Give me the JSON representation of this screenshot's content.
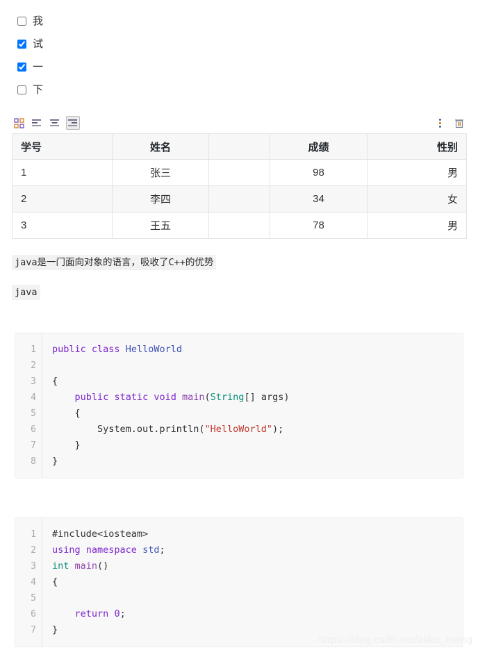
{
  "task_list": {
    "items": [
      {
        "label": "我",
        "checked": false
      },
      {
        "label": "试",
        "checked": true
      },
      {
        "label": "一",
        "checked": true
      },
      {
        "label": "下",
        "checked": false
      }
    ]
  },
  "table_toolbar": {
    "grid_icon": "grid-icon",
    "align_left_icon": "align-left-icon",
    "align_center_icon": "align-center-icon",
    "align_right_icon": "align-right-icon",
    "selected_align": "align-right",
    "more_icon": "more-vertical-icon",
    "delete_icon": "trash-icon"
  },
  "table": {
    "headers": [
      {
        "label": "学号",
        "align": "left"
      },
      {
        "label": "姓名",
        "align": "center"
      },
      {
        "label": "",
        "align": "left"
      },
      {
        "label": "成绩",
        "align": "center"
      },
      {
        "label": "性别",
        "align": "right"
      }
    ],
    "rows": [
      {
        "c0": "1",
        "c1": "张三",
        "c2": "",
        "c3": "98",
        "c4": "男"
      },
      {
        "c0": "2",
        "c1": "李四",
        "c2": "",
        "c3": "34",
        "c4": "女"
      },
      {
        "c0": "3",
        "c1": "王五",
        "c2": "",
        "c3": "78",
        "c4": "男"
      }
    ]
  },
  "paragraphs": {
    "p1_code": "java是一门面向对象的语言，吸收了C++的优势",
    "p2_code": "java"
  },
  "code_blocks": {
    "java": {
      "language": "java",
      "gutter": "1\n2\n3\n4\n5\n6\n7\n8",
      "lines": [
        "public class HelloWorld",
        "",
        "{",
        "    public static void main(String[] args)",
        "    {",
        "        System.out.println(\"HelloWorld\");",
        "    }",
        "}"
      ]
    },
    "cpp": {
      "language": "cpp",
      "gutter": "1\n2\n3\n4\n5\n6\n7",
      "lines": [
        "#include<iosteam>",
        "using namespace std;",
        "int main()",
        "{",
        "",
        "    return 0;",
        "}"
      ]
    }
  },
  "watermark": {
    "text": "https://blog.csdn.net/alike_meng"
  },
  "colors": {
    "keyword": "#7d26cd",
    "class_name": "#3f51b5",
    "type": "#0e8f7e",
    "string": "#c0392b",
    "code_bg": "#f8f8f8",
    "table_stripe": "#f7f7f7",
    "border": "#e3e3e3"
  }
}
